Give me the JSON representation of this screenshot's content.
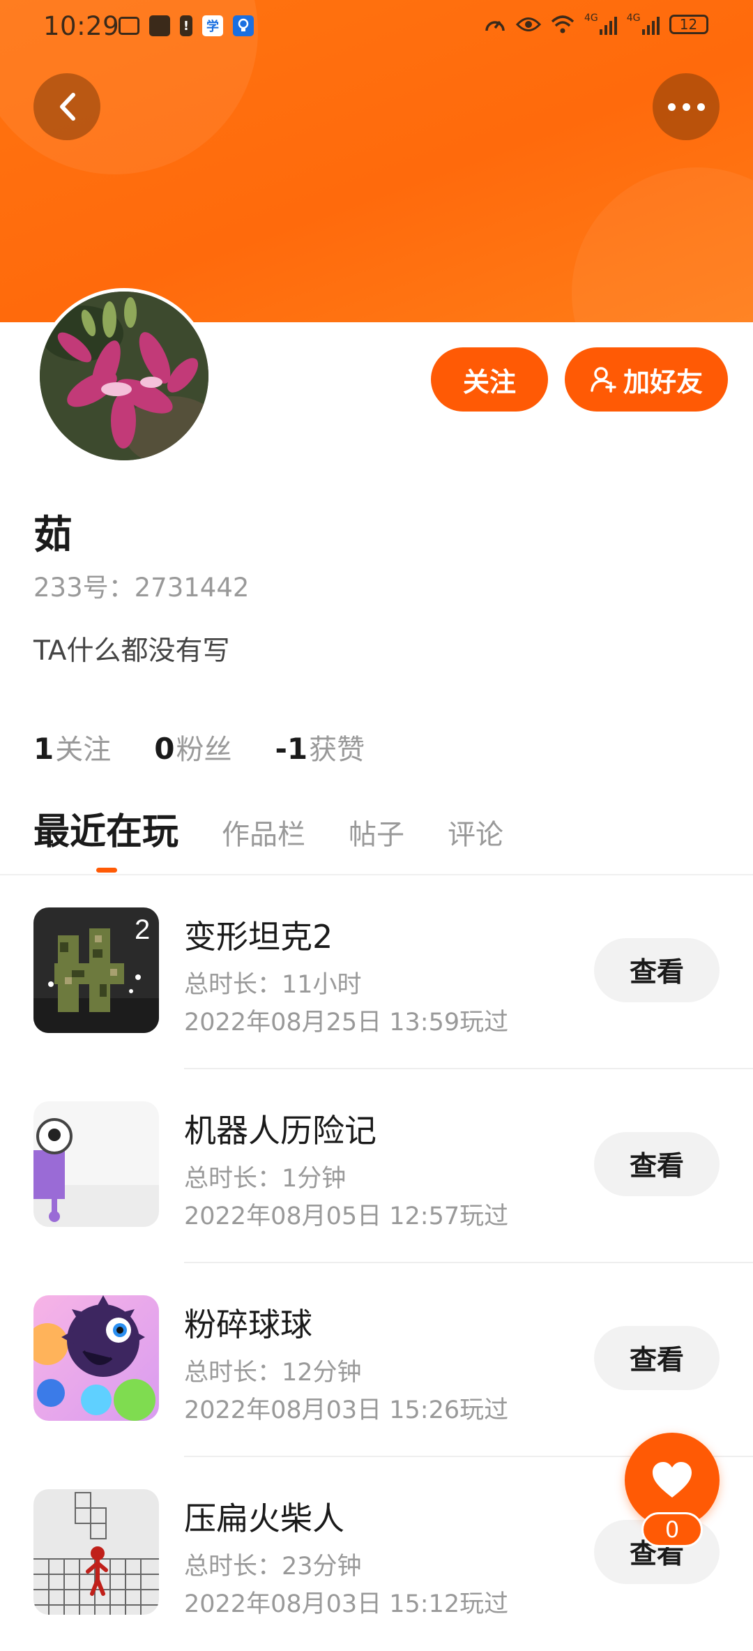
{
  "status_bar": {
    "time": "10:29",
    "battery": "12",
    "network_1": "4G",
    "network_2": "4G"
  },
  "profile": {
    "username": "茹",
    "user_id": "233号：2731442",
    "bio": "TA什么都没有写",
    "follow_label": "关注",
    "add_friend_label": "加好友",
    "stats": [
      {
        "num": "1",
        "label": "关注"
      },
      {
        "num": "0",
        "label": "粉丝"
      },
      {
        "num": "-1",
        "label": "获赞"
      }
    ]
  },
  "tabs": [
    "最近在玩",
    "作品栏",
    "帖子",
    "评论"
  ],
  "active_tab": "最近在玩",
  "games": [
    {
      "name": "变形坦克2",
      "duration": "总时长：11小时",
      "date": "2022年08月25日 13:59玩过",
      "button": "查看"
    },
    {
      "name": "机器人历险记",
      "duration": "总时长：1分钟",
      "date": "2022年08月05日 12:57玩过",
      "button": "查看"
    },
    {
      "name": "粉碎球球",
      "duration": "总时长：12分钟",
      "date": "2022年08月03日 15:26玩过",
      "button": "查看"
    },
    {
      "name": "压扁火柴人",
      "duration": "总时长：23分钟",
      "date": "2022年08月03日 15:12玩过",
      "button": "查看"
    }
  ],
  "like": {
    "count": "0"
  },
  "colors": {
    "accent": "#ff5a05",
    "header": "#ff7410"
  },
  "icons": {
    "back": "chevron-left-icon",
    "more": "more-dots-icon",
    "like": "heart-icon",
    "add_friend": "add-user-icon"
  }
}
